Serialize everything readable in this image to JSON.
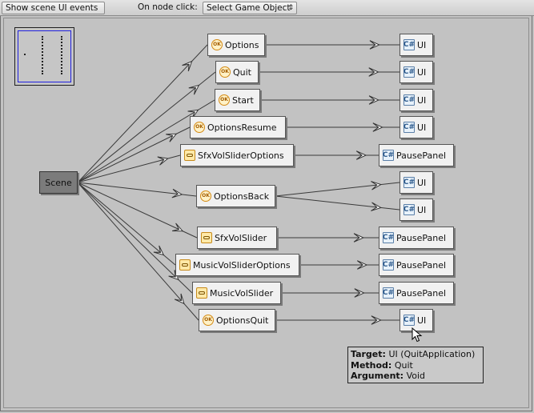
{
  "toolbar": {
    "show_events_label": "Show scene UI events",
    "on_node_click_label": "On node click:",
    "node_click_selection": "Select Game Object",
    "dropdown_arrow": "⇕"
  },
  "graph": {
    "root": "Scene",
    "icons": {
      "ok": "OK",
      "slider": "slider-icon",
      "script": "C#"
    },
    "sources": [
      {
        "label": "Options",
        "icon": "ok"
      },
      {
        "label": "Quit",
        "icon": "ok"
      },
      {
        "label": "Start",
        "icon": "ok"
      },
      {
        "label": "OptionsResume",
        "icon": "ok"
      },
      {
        "label": "SfxVolSliderOptions",
        "icon": "slider"
      },
      {
        "label": "OptionsBack",
        "icon": "ok"
      },
      {
        "label": "SfxVolSlider",
        "icon": "slider"
      },
      {
        "label": "MusicVolSliderOptions",
        "icon": "slider"
      },
      {
        "label": "MusicVolSlider",
        "icon": "slider"
      },
      {
        "label": "OptionsQuit",
        "icon": "ok"
      }
    ],
    "targets": [
      {
        "label": "UI"
      },
      {
        "label": "UI"
      },
      {
        "label": "UI"
      },
      {
        "label": "UI"
      },
      {
        "label": "PausePanel"
      },
      {
        "label": "UI"
      },
      {
        "label": "UI"
      },
      {
        "label": "PausePanel"
      },
      {
        "label": "PausePanel"
      },
      {
        "label": "PausePanel"
      },
      {
        "label": "UI"
      }
    ]
  },
  "tooltip": {
    "target_key": "Target:",
    "target_value": "UI (QuitApplication)",
    "method_key": "Method:",
    "method_value": "Quit",
    "argument_key": "Argument:",
    "argument_value": "Void"
  }
}
